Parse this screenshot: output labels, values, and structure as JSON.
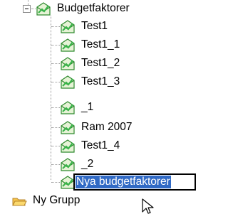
{
  "tree": {
    "root": {
      "label": "Budgetfaktorer",
      "icon": "envelope-icon",
      "expanded": true
    },
    "children": [
      {
        "label": "Test1",
        "icon": "envelope-icon"
      },
      {
        "label": "Test1_1",
        "icon": "envelope-icon"
      },
      {
        "label": "Test1_2",
        "icon": "envelope-icon"
      },
      {
        "label": "Test1_3",
        "icon": "envelope-icon"
      },
      {
        "label": "_1",
        "icon": "envelope-icon"
      },
      {
        "label": "Ram 2007",
        "icon": "envelope-icon"
      },
      {
        "label": "Test1_4",
        "icon": "envelope-icon"
      },
      {
        "label": "_2",
        "icon": "envelope-icon"
      }
    ],
    "editing_node": {
      "value": "Nya budgetfaktorer",
      "icon": "envelope-icon"
    },
    "sibling_group": {
      "label": "Ny Grupp",
      "icon": "folder-icon"
    }
  },
  "colors": {
    "selection": "#316ac5",
    "envelope_body": "#e6f3d6",
    "envelope_stroke": "#2f8a2f",
    "envelope_arrow": "#39b54a",
    "folder_yellow": "#f6c44a"
  }
}
